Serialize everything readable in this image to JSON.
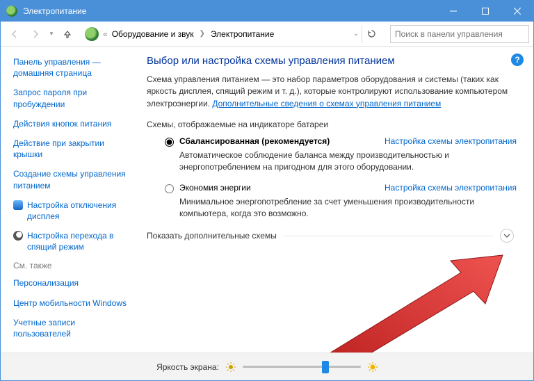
{
  "window": {
    "title": "Электропитание"
  },
  "breadcrumb": {
    "part1": "Оборудование и звук",
    "part2": "Электропитание"
  },
  "search": {
    "placeholder": "Поиск в панели управления"
  },
  "sidebar": {
    "home": "Панель управления — домашняя страница",
    "items": [
      "Запрос пароля при пробуждении",
      "Действия кнопок питания",
      "Действие при закрытии крышки",
      "Создание схемы управления питанием",
      "Настройка отключения дисплея",
      "Настройка перехода в спящий режим"
    ],
    "see_also_h": "См. также",
    "see_also": [
      "Персонализация",
      "Центр мобильности Windows",
      "Учетные записи пользователей"
    ]
  },
  "main": {
    "title": "Выбор или настройка схемы управления питанием",
    "desc": "Схема управления питанием — это набор параметров оборудования и системы (таких как яркость дисплея, спящий режим и т. д.), которые контролируют использование компьютером электроэнергии. ",
    "desc_link": "Дополнительные сведения о схемах управления питанием",
    "section_h": "Схемы, отображаемые на индикаторе батареи",
    "plans": [
      {
        "name": "Сбалансированная (рекомендуется)",
        "link": "Настройка схемы электропитания",
        "desc": "Автоматическое соблюдение баланса между производительностью и энергопотреблением на пригодном для этого оборудовании.",
        "selected": true
      },
      {
        "name": "Экономия энергии",
        "link": "Настройка схемы электропитания",
        "desc": "Минимальное энергопотребление за счет уменьшения производительности компьютера, когда это возможно.",
        "selected": false
      }
    ],
    "expand": "Показать дополнительные схемы"
  },
  "footer": {
    "brightness_label": "Яркость экрана:"
  },
  "help": "?"
}
